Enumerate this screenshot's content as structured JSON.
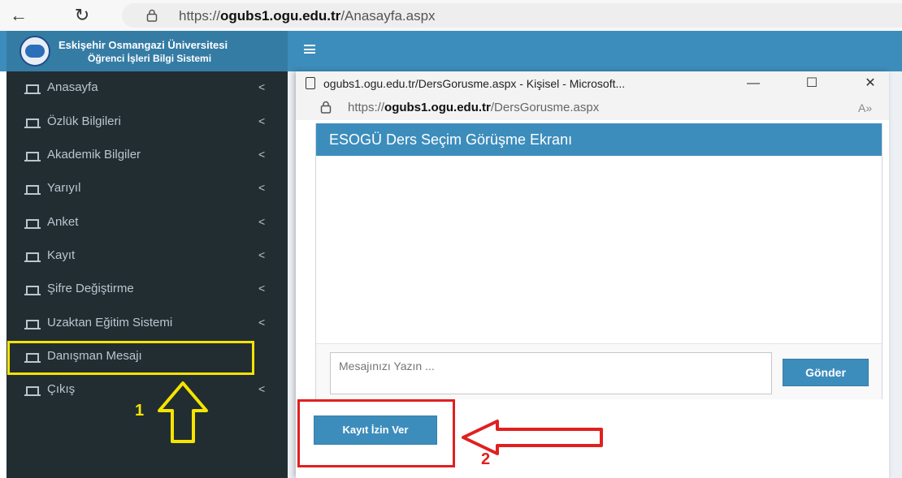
{
  "browser": {
    "back_icon": "←",
    "refresh_icon": "↻",
    "url_prefix": "https://",
    "url_host": "ogubs1.ogu.edu.tr",
    "url_path": "/Anasayfa.aspx"
  },
  "header": {
    "brand_line1": "Eskişehir Osmangazi Üniversitesi",
    "brand_line2": "Öğrenci İşleri Bilgi Sistemi"
  },
  "sidebar": {
    "items": [
      {
        "label": "Anasayfa",
        "caret": "<"
      },
      {
        "label": "Özlük Bilgileri",
        "caret": "<"
      },
      {
        "label": "Akademik Bilgiler",
        "caret": "<"
      },
      {
        "label": "Yarıyıl",
        "caret": "<"
      },
      {
        "label": "Anket",
        "caret": "<"
      },
      {
        "label": "Kayıt",
        "caret": "<"
      },
      {
        "label": "Şifre Değiştirme",
        "caret": "<"
      },
      {
        "label": "Uzaktan Eğitim Sistemi",
        "caret": "<"
      },
      {
        "label": "Danışman Mesajı",
        "caret": ""
      },
      {
        "label": "Çıkış",
        "caret": "<"
      }
    ]
  },
  "popup": {
    "window_title": "ogubs1.ogu.edu.tr/DersGorusme.aspx - Kişisel - Microsoft...",
    "minimize": "—",
    "maximize": "☐",
    "close": "✕",
    "url_prefix": "https://",
    "url_host": "ogubs1.ogu.edu.tr",
    "url_path": "/DersGorusme.aspx",
    "read_aloud": "A»",
    "panel_title": "ESOGÜ Ders Seçim Görüşme Ekranı",
    "message_placeholder": "Mesajınızı Yazın ...",
    "send_label": "Gönder",
    "approve_label": "Kayıt İzin Ver"
  },
  "annotations": {
    "step1": "1",
    "step2": "2",
    "highlight_yellow": "#f5e400",
    "highlight_red": "#e02020"
  },
  "colors": {
    "primary": "#3c8dbc",
    "sidebar_bg": "#222d32",
    "sidebar_text": "#b8c7ce"
  }
}
